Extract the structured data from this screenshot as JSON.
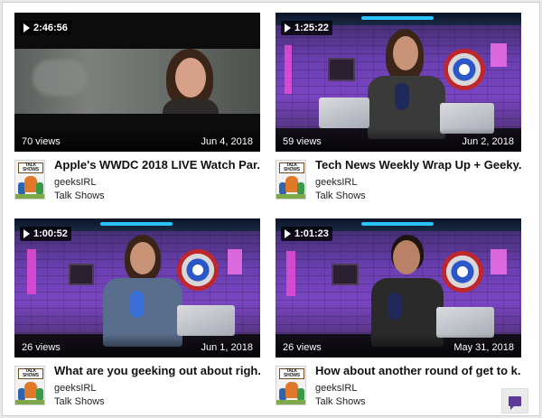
{
  "videos": [
    {
      "duration": "2:46:56",
      "views": "70 views",
      "date": "Jun 4, 2018",
      "title": "Apple's WWDC 2018 LIVE Watch Par...",
      "channel": "geeksIRL",
      "category": "Talk Shows",
      "scene": "newscast"
    },
    {
      "duration": "1:25:22",
      "views": "59 views",
      "date": "Jun 2, 2018",
      "title": "Tech News Weekly Wrap Up + Geeky...",
      "channel": "geeksIRL",
      "category": "Talk Shows",
      "scene": "studio"
    },
    {
      "duration": "1:00:52",
      "views": "26 views",
      "date": "Jun 1, 2018",
      "title": "What are you geeking out about righ...",
      "channel": "geeksIRL",
      "category": "Talk Shows",
      "scene": "studio"
    },
    {
      "duration": "1:01:23",
      "views": "26 views",
      "date": "May 31, 2018",
      "title": "How about another round of get to k...",
      "channel": "geeksIRL",
      "category": "Talk Shows",
      "scene": "studio"
    }
  ],
  "avatar": {
    "sign_text": "TALK SHOWS"
  },
  "icons": {
    "play": "play-icon",
    "chat": "chat-icon"
  },
  "colors": {
    "accent": "#5b3a9a",
    "title_text": "#111111"
  }
}
